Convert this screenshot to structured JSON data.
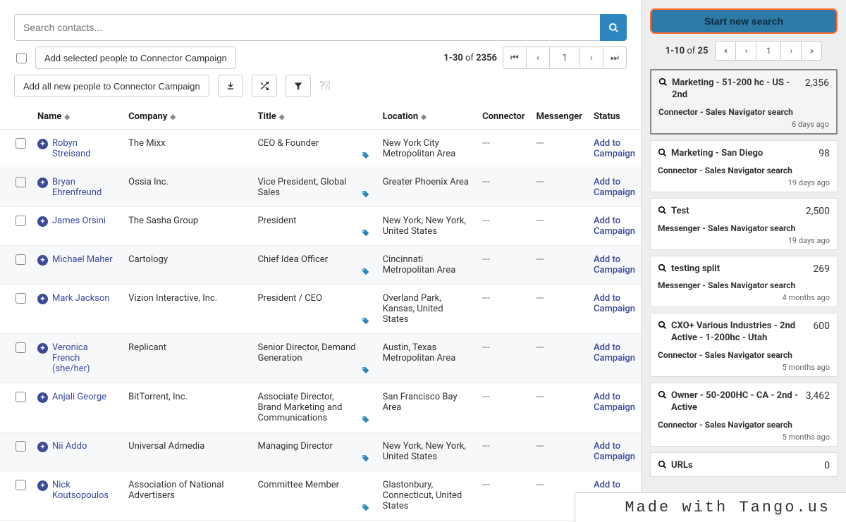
{
  "search": {
    "placeholder": "Search contacts..."
  },
  "buttons": {
    "add_selected": "Add selected people to Connector Campaign",
    "add_all_new": "Add all new people to Connector Campaign",
    "start_new_search": "Start new search"
  },
  "pager_main": {
    "range": "1-30",
    "of_word": "of",
    "total": "2356",
    "page": "1"
  },
  "columns": {
    "name": "Name",
    "company": "Company",
    "title": "Title",
    "location": "Location",
    "connector": "Connector",
    "messenger": "Messenger",
    "status": "Status"
  },
  "rows": [
    {
      "name": "Robyn Streisand",
      "company": "The Mixx",
      "title": "CEO & Founder",
      "location": "New York City Metropolitan Area",
      "connector": "---",
      "messenger": "---",
      "status": "Add to Campaign"
    },
    {
      "name": "Bryan Ehrenfreund",
      "company": "Ossia Inc.",
      "title": "Vice President, Global Sales",
      "location": "Greater Phoenix Area",
      "connector": "---",
      "messenger": "---",
      "status": "Add to Campaign"
    },
    {
      "name": "James Orsini",
      "company": "The Sasha Group",
      "title": "President",
      "location": "New York, New York, United States",
      "connector": "---",
      "messenger": "---",
      "status": "Add to Campaign"
    },
    {
      "name": "Michael Maher",
      "company": "Cartology",
      "title": "Chief Idea Officer",
      "location": "Cincinnati Metropolitan Area",
      "connector": "---",
      "messenger": "---",
      "status": "Add to Campaign"
    },
    {
      "name": "Mark Jackson",
      "company": "Vizion Interactive, Inc.",
      "title": "President / CEO",
      "location": "Overland Park, Kansas, United States",
      "connector": "---",
      "messenger": "---",
      "status": "Add to Campaign"
    },
    {
      "name": "Veronica French (she/her)",
      "company": "Replicant",
      "title": "Senior Director, Demand Generation",
      "location": "Austin, Texas Metropolitan Area",
      "connector": "---",
      "messenger": "---",
      "status": "Add to Campaign"
    },
    {
      "name": "Anjali George",
      "company": "BitTorrent, Inc.",
      "title": "Associate Director, Brand Marketing and Communications",
      "location": "San Francisco Bay Area",
      "connector": "---",
      "messenger": "---",
      "status": "Add to Campaign"
    },
    {
      "name": "Nii Addo",
      "company": "Universal Admedia",
      "title": "Managing Director",
      "location": "New York, New York, United States",
      "connector": "---",
      "messenger": "---",
      "status": "Add to Campaign"
    },
    {
      "name": "Nick Koutsopoulos",
      "company": "Association of National Advertisers",
      "title": "Committee Member",
      "location": "Glastonbury, Connecticut, United States",
      "connector": "---",
      "messenger": "---",
      "status": "Add to"
    }
  ],
  "side_pager": {
    "range": "1-10",
    "of_word": "of",
    "total": "25",
    "page": "1"
  },
  "saved_searches": [
    {
      "title": "Marketing - 51-200 hc - US - 2nd",
      "count": "2,356",
      "sub": "Connector - Sales Navigator search",
      "time": "6 days ago",
      "selected": true
    },
    {
      "title": "Marketing - San Diego",
      "count": "98",
      "sub": "Connector - Sales Navigator search",
      "time": "19 days ago",
      "selected": false
    },
    {
      "title": "Test",
      "count": "2,500",
      "sub": "Messenger - Sales Navigator search",
      "time": "19 days ago",
      "selected": false
    },
    {
      "title": "testing split",
      "count": "269",
      "sub": "Messenger - Sales Navigator search",
      "time": "4 months ago",
      "selected": false
    },
    {
      "title": "CXO+ Various Industries - 2nd Active - 1-200hc - Utah",
      "count": "600",
      "sub": "Connector - Sales Navigator search",
      "time": "5 months ago",
      "selected": false
    },
    {
      "title": "Owner - 50-200HC - CA - 2nd - Active",
      "count": "3,462",
      "sub": "Connector - Sales Navigator search",
      "time": "5 months ago",
      "selected": false
    },
    {
      "title": "URLs",
      "count": "0",
      "sub": "",
      "time": "",
      "selected": false
    }
  ],
  "watermark": "Made with Tango.us"
}
